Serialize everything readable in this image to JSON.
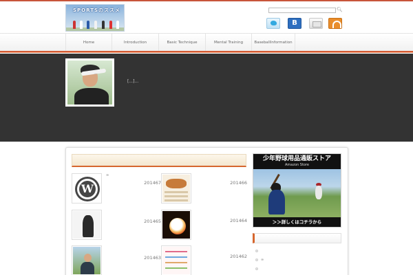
{
  "header": {
    "logo_text": "SPORTSのススメ",
    "search": {
      "placeholder": "",
      "value": ""
    },
    "hatena_label": "B",
    "rss_label": "RSS"
  },
  "nav": {
    "items": [
      {
        "label": "Home"
      },
      {
        "label": "Introduction"
      },
      {
        "label": "Basic Technique"
      },
      {
        "label": "Mental Training"
      },
      {
        "label": "BaseballInformation"
      }
    ]
  },
  "hero": {
    "excerpt": "[...]..."
  },
  "posts": [
    {
      "date": "201467",
      "title": "∞",
      "thumb": "wordpress-logo"
    },
    {
      "date": "201466",
      "title": "",
      "thumb": "food-menu"
    },
    {
      "date": "201465",
      "title": "",
      "thumb": "bw-player"
    },
    {
      "date": "201464",
      "title": "",
      "thumb": "fire-baseball"
    },
    {
      "date": "201463",
      "title": "",
      "thumb": "woman-portrait"
    },
    {
      "date": "201462",
      "title": "",
      "thumb": "chart-doc"
    }
  ],
  "sidebar": {
    "banner": {
      "title": "少年野球用品通販ストア",
      "subtitle": "Amazon Store",
      "cta": "＞＞詳しくはコチラから"
    },
    "widget_items": [
      {
        "label": ""
      },
      {
        "label": "∞"
      },
      {
        "label": ""
      }
    ]
  },
  "colors": {
    "accent": "#d6662e",
    "hero_bg": "#333333",
    "hatena": "#2e6fc0",
    "rss": "#e98d2b"
  }
}
